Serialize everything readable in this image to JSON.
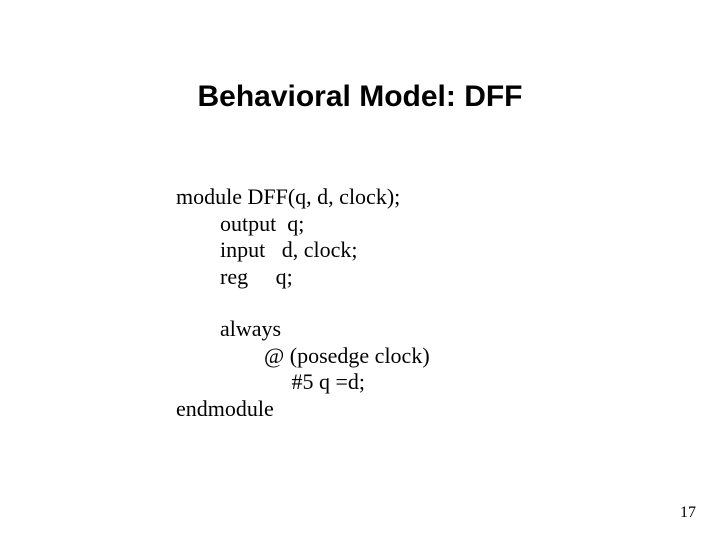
{
  "title": "Behavioral Model: DFF",
  "code": {
    "l1": "module DFF(q, d, clock);",
    "l2": "        output  q;",
    "l3": "        input   d, clock;",
    "l4": "        reg     q;",
    "l5": "",
    "l6": "        always",
    "l7": "                @ (posedge clock)",
    "l8": "                     #5 q =d;",
    "l9": "endmodule"
  },
  "page_number": "17"
}
